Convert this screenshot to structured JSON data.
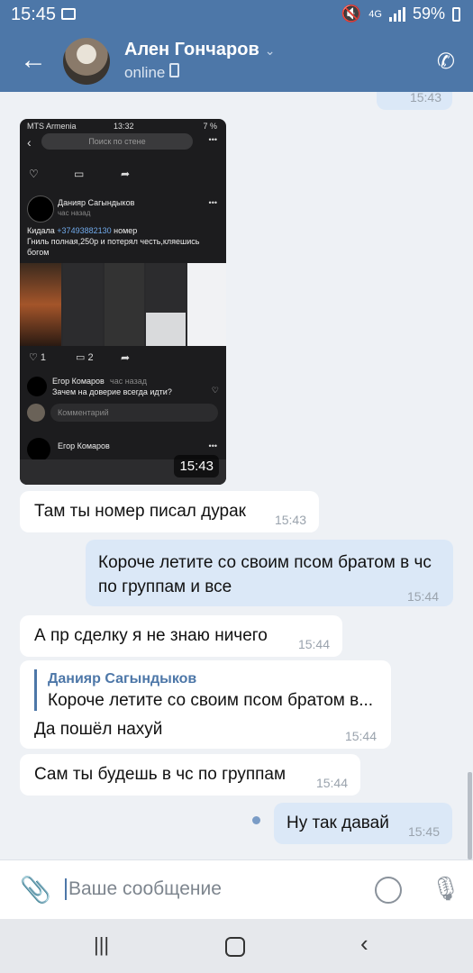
{
  "status": {
    "time": "15:45",
    "network": "4G",
    "battery": "59%"
  },
  "header": {
    "name": "Ален Гончаров",
    "status": "online"
  },
  "photo": {
    "carrier": "MTS Armenia",
    "time": "13:32",
    "battery": "7 %",
    "search": "Поиск по стене",
    "post_author": "Данияр Сагындыков",
    "post_time": "час назад",
    "post_line1_prefix": "Кидала ",
    "post_phone": "+37493882130",
    "post_line1_suffix": " номер",
    "post_line2": "Гниль полная,250р и потерял честь,кляешись богом",
    "likes": "1",
    "comments": "2",
    "c1_author": "Егор Комаров",
    "c1_time": "час назад",
    "c1_text": "Зачем на доверие всегда идти?",
    "comment_placeholder": "Комментарий",
    "c2_author": "Егор Комаров",
    "timestamp": "15:43"
  },
  "messages": [
    {
      "text": "Там ты номер писал дурак",
      "time": "15:43"
    },
    {
      "text": "Короче летите со своим псом братом в чс по группам и все",
      "time": "15:44"
    },
    {
      "text": "А пр сделку я не знаю ничего",
      "time": "15:44"
    },
    {
      "quote_author": "Данияр Сагындыков",
      "quote_text": "Короче летите со своим псом братом в...",
      "text": "Да пошёл нахуй",
      "time": "15:44"
    },
    {
      "text": "Сам ты будешь в чс по группам",
      "time": "15:44"
    },
    {
      "text": "Ну так давай",
      "time": "15:45"
    }
  ],
  "top_bubble_time": "15:43",
  "composer": {
    "placeholder": "Ваше сообщение"
  },
  "icons": [
    "back-arrow-icon",
    "phone-icon",
    "attach-icon",
    "emoji-icon",
    "mic-icon",
    "recent-apps-icon",
    "home-icon",
    "back-icon"
  ]
}
